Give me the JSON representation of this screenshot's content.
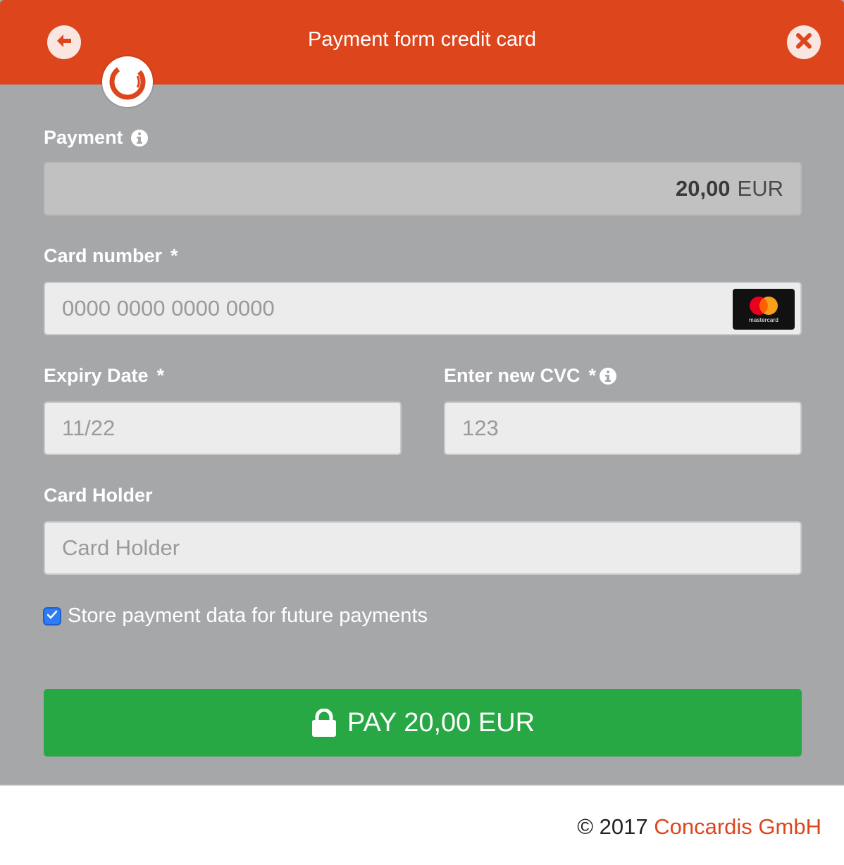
{
  "header": {
    "title": "Payment form credit card",
    "back_icon": "arrow-left-icon",
    "close_icon": "close-icon",
    "logo": "concardis-logo"
  },
  "form": {
    "payment": {
      "label": "Payment",
      "amount": "20,00",
      "currency": "EUR"
    },
    "card_number": {
      "label": "Card number",
      "required_mark": "*",
      "placeholder": "0000 0000 0000 0000",
      "brand_text": "mastercard"
    },
    "expiry": {
      "label": "Expiry Date",
      "required_mark": "*",
      "placeholder": "11/22"
    },
    "cvc": {
      "label": "Enter new CVC",
      "required_mark": "*",
      "placeholder": "123"
    },
    "holder": {
      "label": "Card Holder",
      "placeholder": "Card Holder"
    },
    "store": {
      "label": "Store payment data for future payments",
      "checked": true
    }
  },
  "pay_button": {
    "label": "PAY 20,00 EUR"
  },
  "footer": {
    "copyright": "© 2017",
    "company": "Concardis GmbH"
  },
  "colors": {
    "brand": "#dd461d",
    "pay": "#28a745",
    "background": "#a6a7a9"
  }
}
